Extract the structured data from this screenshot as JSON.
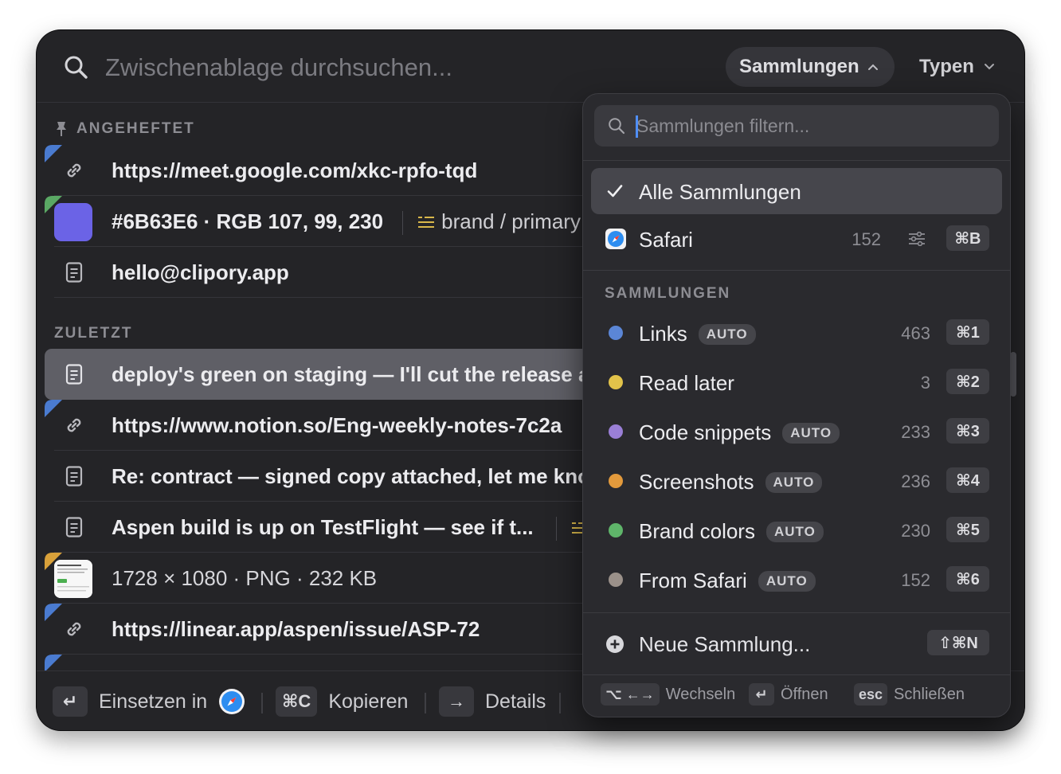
{
  "search": {
    "placeholder": "Zwischenablage durchsuchen..."
  },
  "header": {
    "collections_label": "Sammlungen",
    "types_label": "Typen"
  },
  "pinned": {
    "heading": "ANGEHEFTET",
    "items": [
      {
        "text": "https://meet.google.com/xkc-rpfo-tqd",
        "kind": "link",
        "corner_color": "#4a7bd0"
      },
      {
        "text": "#6B63E6 · RGB 107, 99, 230",
        "kind": "color",
        "swatch": "#6B63E6",
        "corner_color": "#5aa864",
        "meta": "brand / primary"
      },
      {
        "text": "hello@clipory.app",
        "kind": "text"
      }
    ]
  },
  "recent": {
    "heading": "ZULETZT",
    "items": [
      {
        "text": "deploy's green on staging — I'll cut the release a",
        "kind": "text",
        "selected": true
      },
      {
        "text": "https://www.notion.so/Eng-weekly-notes-7c2a",
        "kind": "link",
        "corner_color": "#4a7bd0"
      },
      {
        "text": "Re: contract — signed copy attached, let me kno",
        "kind": "text"
      },
      {
        "text": "Aspen build is up on TestFlight — see if t...",
        "kind": "text"
      },
      {
        "text": "1728 × 1080 · PNG · 232 KB",
        "kind": "image",
        "corner_color": "#d9a13a"
      },
      {
        "text": "https://linear.app/aspen/issue/ASP-72",
        "kind": "link",
        "corner_color": "#4a7bd0"
      }
    ]
  },
  "footer": {
    "paste_key": "↵",
    "paste_label": "Einsetzen in",
    "copy_key": "⌘C",
    "copy_label": "Kopieren",
    "details_key": "→",
    "details_label": "Details"
  },
  "dropdown": {
    "filter_placeholder": "Sammlungen filtern...",
    "all": {
      "label": "Alle Sammlungen",
      "checked": true
    },
    "safari": {
      "label": "Safari",
      "count": "152",
      "shortcut": "⌘B"
    },
    "section_heading": "SAMMLUNGEN",
    "collections": [
      {
        "label": "Links",
        "auto": "AUTO",
        "count": "463",
        "shortcut": "⌘1",
        "color": "#5b86d6"
      },
      {
        "label": "Read later",
        "auto": "",
        "count": "3",
        "shortcut": "⌘2",
        "color": "#e2c34a"
      },
      {
        "label": "Code snippets",
        "auto": "AUTO",
        "count": "233",
        "shortcut": "⌘3",
        "color": "#9a7fd6"
      },
      {
        "label": "Screenshots",
        "auto": "AUTO",
        "count": "236",
        "shortcut": "⌘4",
        "color": "#e39a3c"
      },
      {
        "label": "Brand colors",
        "auto": "AUTO",
        "count": "230",
        "shortcut": "⌘5",
        "color": "#5fb56a"
      },
      {
        "label": "From Safari",
        "auto": "AUTO",
        "count": "152",
        "shortcut": "⌘6",
        "color": "#9b918a"
      }
    ],
    "new_collection": {
      "label": "Neue Sammlung...",
      "shortcut": "⇧⌘N"
    },
    "hints": {
      "switch_key": "⌥ ←→",
      "switch_label": "Wechseln",
      "open_key": "↵",
      "open_label": "Öffnen",
      "close_key": "esc",
      "close_label": "Schließen"
    }
  }
}
